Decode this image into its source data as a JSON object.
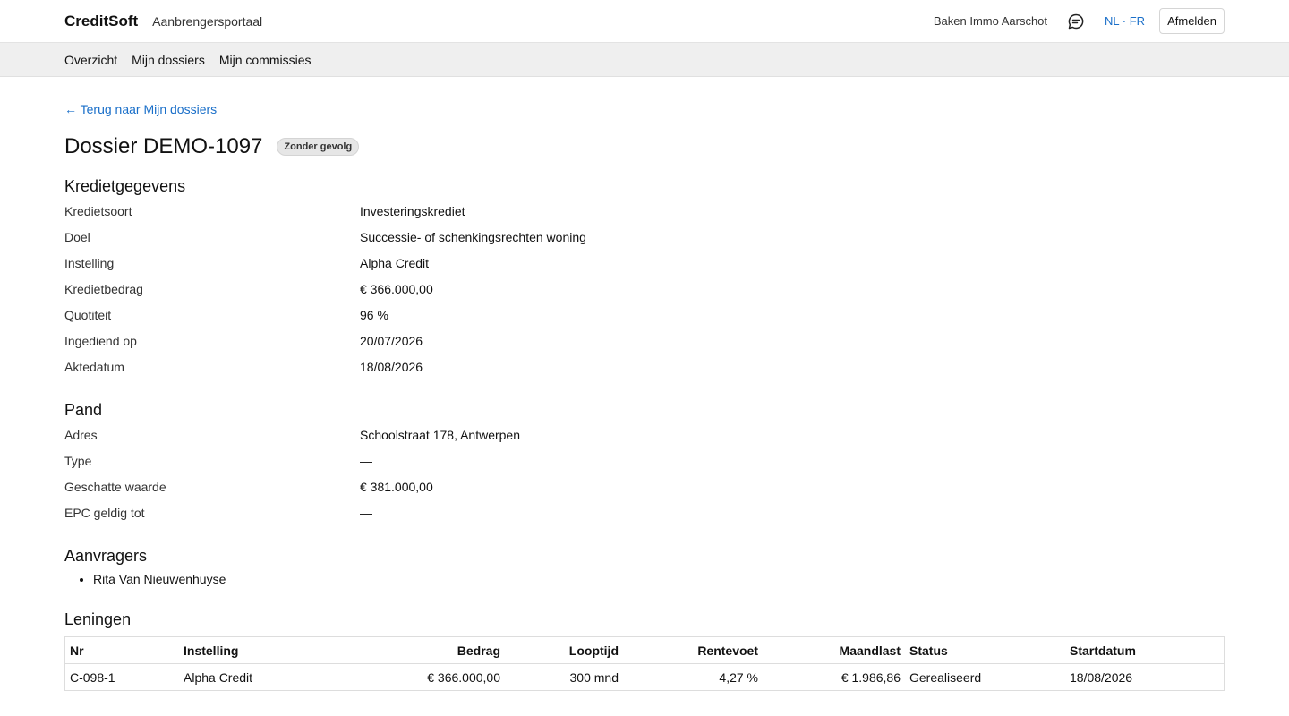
{
  "header": {
    "brand": "CreditSoft",
    "portal": "Aanbrengersportaal",
    "agency": "Baken Immo Aarschot",
    "lang_nl": "NL",
    "lang_sep": " · ",
    "lang_fr": "FR",
    "logout": "Afmelden"
  },
  "nav": {
    "items": [
      "Overzicht",
      "Mijn dossiers",
      "Mijn commissies"
    ]
  },
  "back_link": "← Terug naar Mijn dossiers",
  "dossier": {
    "title": "Dossier DEMO-1097",
    "status_badge": "Zonder gevolg"
  },
  "credit": {
    "heading": "Kredietgegevens",
    "rows": [
      {
        "label": "Kredietsoort",
        "value": "Investeringskrediet"
      },
      {
        "label": "Doel",
        "value": "Successie- of schenkingsrechten woning"
      },
      {
        "label": "Instelling",
        "value": "Alpha Credit"
      },
      {
        "label": "Kredietbedrag",
        "value": "€ 366.000,00"
      },
      {
        "label": "Quotiteit",
        "value": "96 %"
      },
      {
        "label": "Ingediend op",
        "value": "20/07/2026"
      },
      {
        "label": "Aktedatum",
        "value": "18/08/2026"
      }
    ]
  },
  "property": {
    "heading": "Pand",
    "rows": [
      {
        "label": "Adres",
        "value": "Schoolstraat 178, Antwerpen"
      },
      {
        "label": "Type",
        "value": "—"
      },
      {
        "label": "Geschatte waarde",
        "value": "€ 381.000,00"
      },
      {
        "label": "EPC geldig tot",
        "value": "—"
      }
    ]
  },
  "applicants": {
    "heading": "Aanvragers",
    "items": [
      "Rita Van Nieuwenhuyse"
    ]
  },
  "loans": {
    "heading": "Leningen",
    "columns": [
      "Nr",
      "Instelling",
      "Bedrag",
      "Looptijd",
      "Rentevoet",
      "Maandlast",
      "Status",
      "Startdatum"
    ],
    "rows": [
      [
        "C-098-1",
        "Alpha Credit",
        "€ 366.000,00",
        "300 mnd",
        "4,27 %",
        "€ 1.986,86",
        "Gerealiseerd",
        "18/08/2026"
      ]
    ]
  }
}
